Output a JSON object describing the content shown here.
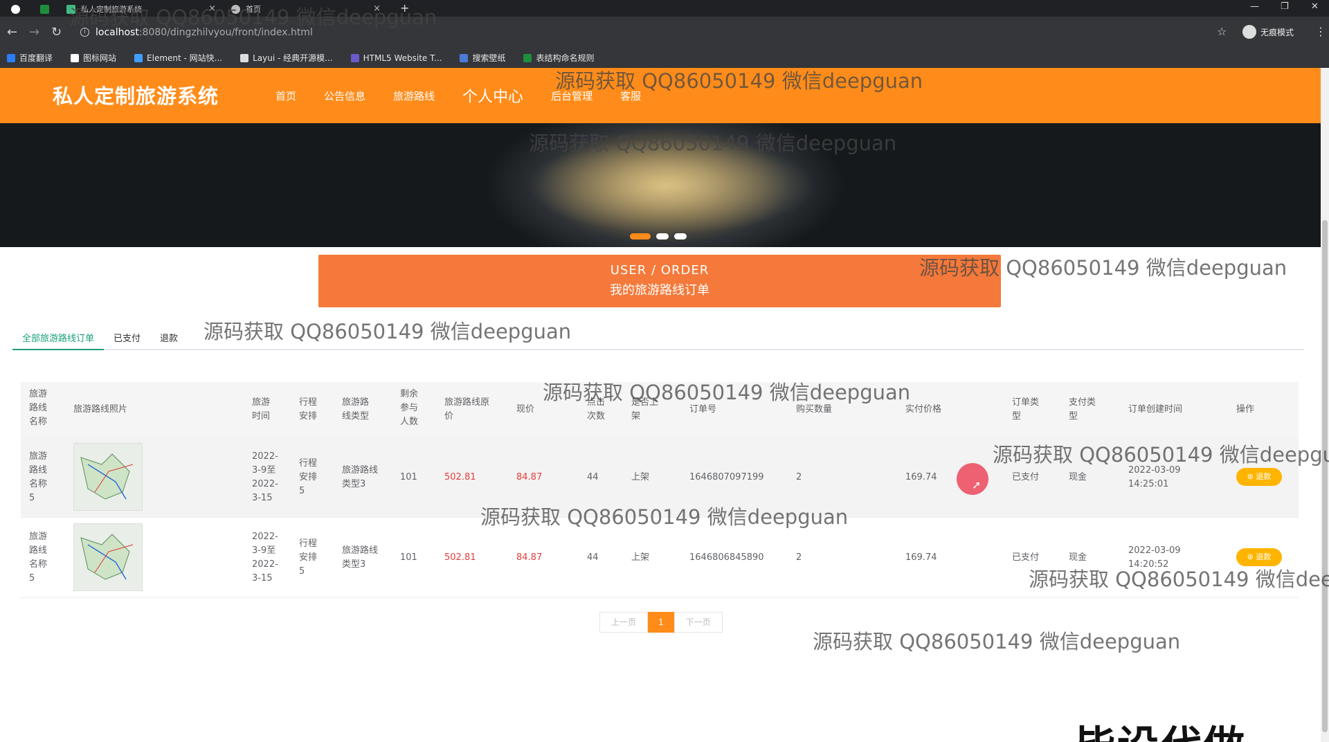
{
  "browser": {
    "tabs": [
      {
        "label": "私人定制旅游系统"
      },
      {
        "label": "首页"
      }
    ],
    "url_host": "localhost",
    "url_path": ":8080/dingzhilvyou/front/index.html",
    "profile_label": "无痕模式",
    "bookmarks": [
      "百度翻译",
      "图标网站",
      "Element - 网站快...",
      "Layui - 经典开源模...",
      "HTML5 Website T...",
      "搜索壁纸",
      "表结构命名规则"
    ]
  },
  "header": {
    "brand": "私人定制旅游系统",
    "nav": [
      "首页",
      "公告信息",
      "旅游路线",
      "个人中心",
      "后台管理",
      "客服"
    ]
  },
  "title_box": {
    "en": "USER / ORDER",
    "cn": "我的旅游路线订单"
  },
  "tabs": [
    "全部旅游路线订单",
    "已支付",
    "退款"
  ],
  "table": {
    "headers": [
      "旅游路线名称",
      "旅游路线照片",
      "旅游时间",
      "行程安排",
      "旅游路线类型",
      "剩余参与人数",
      "旅游路线原价",
      "现价",
      "点击次数",
      "是否上架",
      "订单号",
      "购买数量",
      "实付价格",
      "订单类型",
      "支付类型",
      "订单创建时间",
      "操作"
    ],
    "rows": [
      {
        "name": "旅游路线名称5",
        "time": "2022-3-9至2022-3-15",
        "schedule": "行程安排5",
        "type": "旅游路线类型3",
        "remaining": "101",
        "orig_price": "502.81",
        "price": "84.87",
        "clicks": "44",
        "on_shelf": "上架",
        "order_no": "1646807097199",
        "qty": "2",
        "paid": "169.74",
        "order_type": "已支付",
        "pay_type": "现金",
        "created": "2022-03-09 14:25:01",
        "action": "退款"
      },
      {
        "name": "旅游路线名称5",
        "time": "2022-3-9至2022-3-15",
        "schedule": "行程安排5",
        "type": "旅游路线类型3",
        "remaining": "101",
        "orig_price": "502.81",
        "price": "84.87",
        "clicks": "44",
        "on_shelf": "上架",
        "order_no": "1646806845890",
        "qty": "2",
        "paid": "169.74",
        "order_type": "已支付",
        "pay_type": "现金",
        "created": "2022-03-09 14:20:52",
        "action": "退款"
      }
    ]
  },
  "pager": {
    "prev": "上一页",
    "current": "1",
    "next": "下一页"
  },
  "watermark": "源码获取 QQ86050149 微信deepguan",
  "stamp": "毕设代做",
  "colors": {
    "header": "#ff8c1a",
    "title_box": "#f4793a",
    "tab_active": "#1aa07d",
    "price_red": "#e43c3c",
    "refund_button": "#ffb400"
  }
}
